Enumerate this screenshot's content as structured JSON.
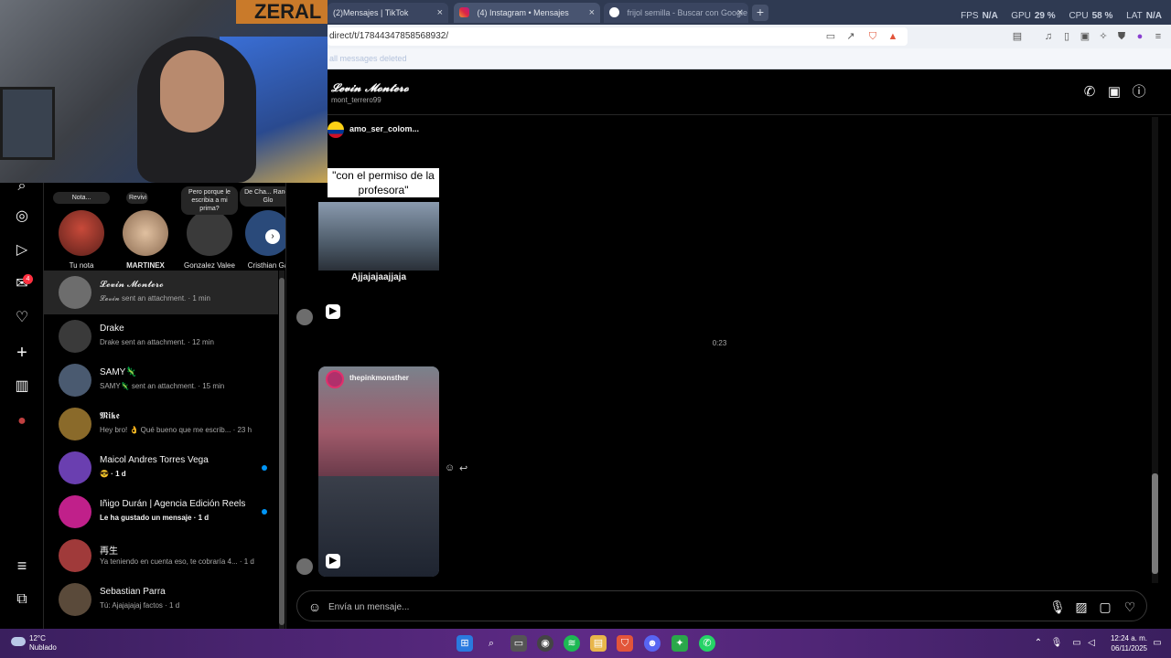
{
  "webcam": {
    "logo_text": "ZERAL"
  },
  "browser": {
    "tabs": [
      {
        "label": "(2)Mensajes | TikTok"
      },
      {
        "label": "(4) Instagram • Mensajes"
      },
      {
        "label": "frijol semilla - Buscar con Google"
      }
    ],
    "new_tab": "+",
    "close_glyph": "×",
    "url": "direct/t/17844347858568932/",
    "bookmark_text": "all messages deleted"
  },
  "overlay_stats": {
    "fps_label": "FPS",
    "fps_value": "N/A",
    "gpu_label": "GPU",
    "gpu_value": "29 %",
    "cpu_label": "CPU",
    "cpu_value": "58 %",
    "lat_label": "LAT",
    "lat_value": "N/A"
  },
  "rail": {
    "icons": [
      "search-icon",
      "explore-icon",
      "reels-icon",
      "messenger-icon",
      "heart-icon",
      "create-icon",
      "dashboard-icon",
      "profile-icon",
      "menu-icon",
      "meta-icon"
    ],
    "messages_badge": "4"
  },
  "stories": [
    {
      "name": "Tu nota",
      "note": "Nota..."
    },
    {
      "name": "MARTINEX",
      "note": "Revivi"
    },
    {
      "name": "Gonzalez Valee",
      "note": "Pero porque le escribia a mi prima?"
    },
    {
      "name": "Cristhian Ga",
      "note": "De Cha... Randy Glo"
    }
  ],
  "conversations": [
    {
      "name": "𝓛𝓮𝓿𝓲𝓷 𝓜𝓸𝓷𝓽𝓮𝓻𝓸",
      "sub": "𝓛𝓮𝓿𝓲𝓷 sent an attachment. · 1 min",
      "active": true,
      "unread": false,
      "color": "#6d6d6d"
    },
    {
      "name": "Drake",
      "sub": "Drake sent an attachment. · 12 min",
      "active": false,
      "unread": false,
      "color": "#3a3a3a"
    },
    {
      "name": "SAMY🦎",
      "sub": "SAMY🦎 sent an attachment. · 15 min",
      "active": false,
      "unread": false,
      "color": "#4a5a70"
    },
    {
      "name": "𝕸𝖎𝖐𝖊",
      "sub": "Hey bro! 👌 Qué bueno que me escrib... · 23 h",
      "active": false,
      "unread": false,
      "color": "#8a6a2a"
    },
    {
      "name": "Maicol Andres Torres Vega",
      "sub": "😎 · 1 d",
      "active": false,
      "unread": true,
      "color": "#6a3fb0"
    },
    {
      "name": "Iñigo Durán | Agencia Edición Reels",
      "sub": "Le ha gustado un mensaje · 1 d",
      "active": false,
      "unread": true,
      "color": "#c0208a"
    },
    {
      "name": "再生",
      "sub": "Ya teniendo en cuenta eso, te cobraría 4... · 1 d",
      "active": false,
      "unread": false,
      "color": "#a03a3a"
    },
    {
      "name": "Sebastian Parra",
      "sub": "Tú: Ajajajajaj factos · 1 d",
      "active": false,
      "unread": false,
      "color": "#5a4a3a"
    }
  ],
  "chat": {
    "name": "𝓛𝓮𝓿𝓲𝓷 𝓜𝓸𝓷𝓽𝓮𝓻𝓸",
    "handle": "mont_terrero99",
    "shared_reel_1": {
      "author": "amo_ser_colom...",
      "caption": "\"con el permiso de la profesora\"",
      "subtitle": "Ajjajajaajjaja"
    },
    "timestamp": "0:23",
    "shared_reel_2": {
      "author": "thepinkmonsther"
    },
    "composer_placeholder": "Envía un mensaje..."
  },
  "taskbar": {
    "temperature": "12°C",
    "weather": "Nublado",
    "time": "12:24 a. m.",
    "date": "06/11/2025"
  },
  "colors": {
    "accent": "#0095f6",
    "badge": "#ff3040",
    "taskbar": "#5e2a86"
  }
}
